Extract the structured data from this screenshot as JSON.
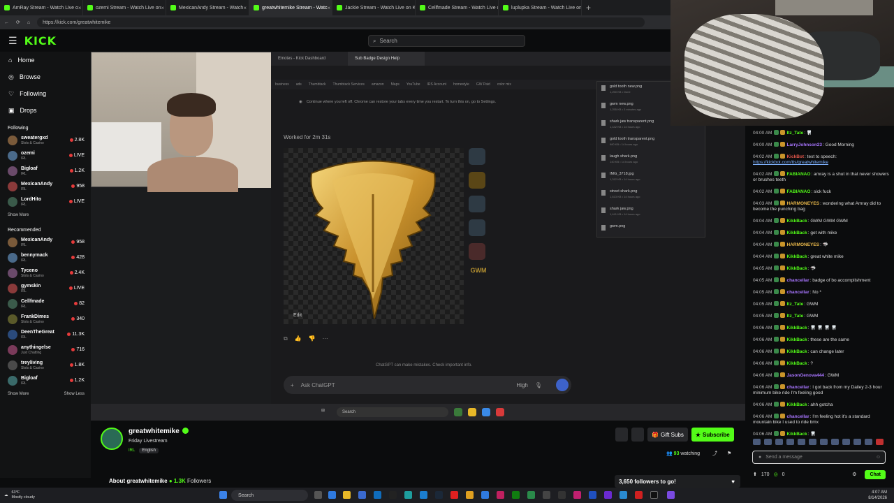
{
  "browser": {
    "tabs": [
      {
        "label": "AmRay Stream - Watch Live o",
        "active": false
      },
      {
        "label": "ozemi Stream - Watch Live on",
        "active": false
      },
      {
        "label": "MexicanAndy Stream - Watch",
        "active": false
      },
      {
        "label": "greatwhitemike Stream - Watc",
        "active": true
      },
      {
        "label": "Jackie Stream - Watch Live on Kick",
        "active": false
      },
      {
        "label": "Cellfmade Stream - Watch Live on",
        "active": false
      },
      {
        "label": "luplupka Stream - Watch Live on K",
        "active": false
      }
    ],
    "url": "https://kick.com/greatwhitemike"
  },
  "kick": {
    "logo": "KICK",
    "search_placeholder": "Search",
    "nav": [
      {
        "label": "Home",
        "icon": "home-icon"
      },
      {
        "label": "Browse",
        "icon": "compass-icon"
      },
      {
        "label": "Following",
        "icon": "heart-icon"
      },
      {
        "label": "Drops",
        "icon": "gift-icon"
      }
    ],
    "following_label": "Following",
    "following": [
      {
        "name": "sweatergxd",
        "category": "Slots & Casino",
        "count": "2.8K"
      },
      {
        "name": "ozemi",
        "category": "IRL",
        "count": "LIVE"
      },
      {
        "name": "Bigloaf",
        "category": "IRL",
        "count": "1.2K"
      },
      {
        "name": "MexicanAndy",
        "category": "IRL",
        "count": "958"
      },
      {
        "name": "LordHito",
        "category": "IRL",
        "count": "LIVE"
      }
    ],
    "show_more_1": "Show More",
    "recommended_label": "Recommended",
    "recommended": [
      {
        "name": "MexicanAndy",
        "category": "IRL",
        "count": "958"
      },
      {
        "name": "bennymack",
        "category": "IRL",
        "count": "428"
      },
      {
        "name": "Tyceno",
        "category": "Slots & Casino",
        "count": "2.4K"
      },
      {
        "name": "gymskin",
        "category": "IRL",
        "count": "LIVE"
      },
      {
        "name": "Cellfmade",
        "category": "IRL",
        "count": "82"
      },
      {
        "name": "FrankDimes",
        "category": "Slots & Casino",
        "count": "340"
      },
      {
        "name": "DeenTheGreat",
        "category": "IRL",
        "count": "11.3K"
      },
      {
        "name": "anythingelse",
        "category": "Just Chatting",
        "count": "716"
      },
      {
        "name": "treyliving",
        "category": "Slots & Casino",
        "count": "1.8K"
      },
      {
        "name": "Bigloaf",
        "category": "IRL",
        "count": "1.2K"
      }
    ],
    "show_more_2": "Show More",
    "show_less": "Show Less"
  },
  "screen": {
    "inner_tabs": [
      "Emotes - Kick Dashboard",
      "Sub Badge Design Help"
    ],
    "bookmarks": [
      "business",
      "ads",
      "Thumbtack",
      "Thumbtack Services",
      "amazon",
      "Maps",
      "YouTube",
      "IRS Account",
      "homestyle",
      "GW Paid",
      "color mix"
    ],
    "restore_text": "Continue where you left off. Chrome can restore your tabs every time you restart. To turn this on, go to Settings.",
    "worked_for": "Worked for 2m 31s",
    "edit_label": "Edit",
    "thumb_text": "GWM",
    "disclaimer": "ChatGPT can make mistakes. Check important info.",
    "ask_placeholder": "Ask ChatGPT",
    "model_level": "High",
    "downloads": [
      {
        "name": "gold tooth new.png",
        "meta": "1,250 KB • Done"
      },
      {
        "name": "gwm new.png",
        "meta": "1,255 KB • 3 minutes ago"
      },
      {
        "name": "shark jaw transparent.png",
        "meta": "1,442 KB • 14 hours ago"
      },
      {
        "name": "gold tooth transparent.png",
        "meta": "980 KB • 14 hours ago"
      },
      {
        "name": "laugh shark.png",
        "meta": "140 KB • 14 hours ago"
      },
      {
        "name": "IMG_3718.jpg",
        "meta": "1,312 KB • 14 hours ago"
      },
      {
        "name": "street shark.png",
        "meta": "1,613 KB • 14 hours ago"
      },
      {
        "name": "shark jaw.png",
        "meta": "1,441 KB • 14 hours ago"
      },
      {
        "name": "gwm.png",
        "meta": ""
      }
    ],
    "inner_search": "Search"
  },
  "chat": {
    "messages": [
      {
        "time": "04:00 AM",
        "user": "Itz_Tate",
        "color": "#53fc18",
        "text": "🦷"
      },
      {
        "time": "04:00 AM",
        "user": "LarryJohnson23",
        "color": "#a875ff",
        "text": "Good Morning"
      },
      {
        "time": "04:02 AM",
        "user": "KickBot",
        "color": "#e0554a",
        "text": "text to speech:",
        "link": "https://kickbot.com/tts/greatwhitemike"
      },
      {
        "time": "04:02 AM",
        "user": "FABIANAO",
        "color": "#53fc18",
        "text": "amray is a shut in that never showers or brushes teeth"
      },
      {
        "time": "04:02 AM",
        "user": "FABIANAO",
        "color": "#53fc18",
        "text": "sick fuck"
      },
      {
        "time": "04:03 AM",
        "user": "HARMONEYES",
        "color": "#e9b84a",
        "text": "wondering what Amray did to become the punching bag"
      },
      {
        "time": "04:04 AM",
        "user": "KikkBack",
        "color": "#53fc18",
        "text": "GWM GWM GWM"
      },
      {
        "time": "04:04 AM",
        "user": "KikkBack",
        "color": "#53fc18",
        "text": "get with mike"
      },
      {
        "time": "04:04 AM",
        "user": "HARMONEYES",
        "color": "#e9b84a",
        "text": "🦈"
      },
      {
        "time": "04:04 AM",
        "user": "KikkBack",
        "color": "#53fc18",
        "text": "great white mike"
      },
      {
        "time": "04:05 AM",
        "user": "KikkBack",
        "color": "#53fc18",
        "text": "🦈"
      },
      {
        "time": "04:05 AM",
        "user": "chancellar",
        "color": "#a875ff",
        "text": "badge of bo accomplishment"
      },
      {
        "time": "04:05 AM",
        "user": "chancellar",
        "color": "#a875ff",
        "text": "No *"
      },
      {
        "time": "04:05 AM",
        "user": "Itz_Tate",
        "color": "#53fc18",
        "text": "GWM"
      },
      {
        "time": "04:05 AM",
        "user": "Itz_Tate",
        "color": "#53fc18",
        "text": "GWM"
      },
      {
        "time": "04:06 AM",
        "user": "KikkBack",
        "color": "#53fc18",
        "text": "🦷 🦷 🦷 🦷"
      },
      {
        "time": "04:06 AM",
        "user": "KikkBack",
        "color": "#53fc18",
        "text": "these are the same"
      },
      {
        "time": "04:06 AM",
        "user": "KikkBack",
        "color": "#53fc18",
        "text": "can change later"
      },
      {
        "time": "04:06 AM",
        "user": "KikkBack",
        "color": "#53fc18",
        "text": "?"
      },
      {
        "time": "04:06 AM",
        "user": "JasonGenova444",
        "color": "#a875ff",
        "text": "GWM"
      },
      {
        "time": "04:06 AM",
        "user": "chancellar",
        "color": "#a875ff",
        "text": "I got back from my Dailey 2-3 hour minimum bike ride I'm feeling good"
      },
      {
        "time": "04:06 AM",
        "user": "KikkBack",
        "color": "#53fc18",
        "text": "ahh gotcha"
      },
      {
        "time": "04:06 AM",
        "user": "chancellar",
        "color": "#a875ff",
        "text": "I'm feeling hot it's a standard mountain bike I used to ride bmx"
      },
      {
        "time": "04:06 AM",
        "user": "KikkBack",
        "color": "#53fc18",
        "text": "🦷"
      }
    ],
    "input_placeholder": "Send a message",
    "points": "170",
    "coins": "0",
    "chat_button": "Chat"
  },
  "channel": {
    "name": "greatwhitemike",
    "title": "Friday Livestream",
    "category": "IRL",
    "language": "English",
    "gift_label": "Gift Subs",
    "subscribe_label": "Subscribe",
    "watching_count": "93",
    "watching_label": "watching",
    "about_label": "About greatwhitemike",
    "followers_count": "1.3K",
    "followers_label": "Followers",
    "goal_text": "3,650 followers to go!",
    "live_badge": "LIVE"
  },
  "taskbar": {
    "temp": "63°F",
    "weather": "Mostly cloudy",
    "search": "Search",
    "time": "4:07 AM",
    "date": "8/14/2026"
  }
}
